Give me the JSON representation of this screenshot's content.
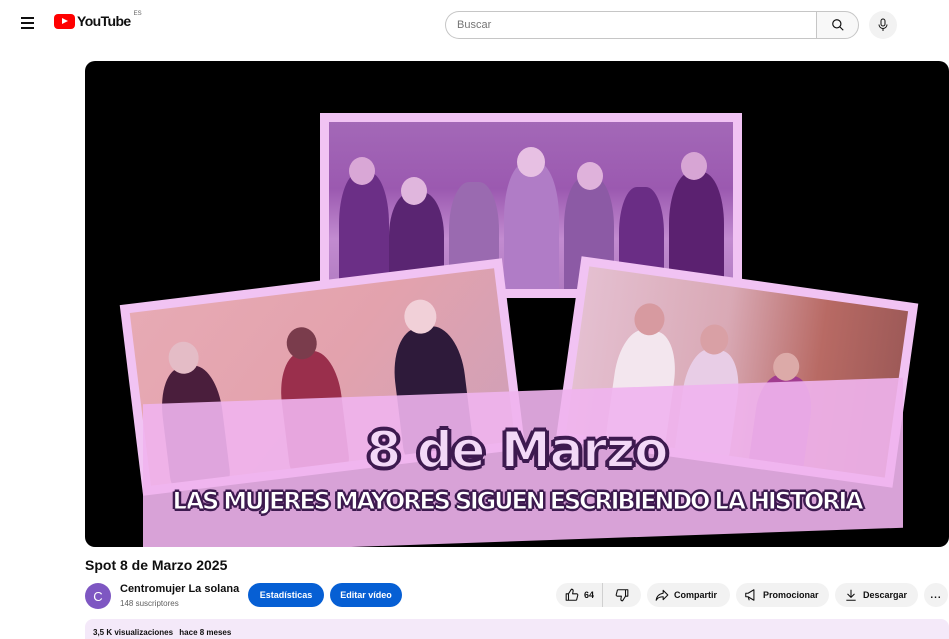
{
  "header": {
    "logo_text": "YouTube",
    "region": "ES",
    "search_placeholder": "Buscar"
  },
  "video": {
    "overlay_title": "8 de Marzo",
    "overlay_subtitle": "LAS MUJERES MAYORES SIGUEN ESCRIBIENDO LA HISTORIA",
    "title": "Spot 8 de Marzo 2025"
  },
  "channel": {
    "avatar_letter": "C",
    "name": "Centromujer La solana",
    "subscribers": "148 suscriptores"
  },
  "actions": {
    "stats_label": "Estadísticas",
    "edit_label": "Editar vídeo",
    "likes": "64",
    "share_label": "Compartir",
    "promote_label": "Promocionar",
    "download_label": "Descargar",
    "more_label": "..."
  },
  "description": {
    "views": "3,5 K visualizaciones",
    "date": "hace 8 meses"
  },
  "colors": {
    "brand_red": "#ff0000",
    "button_blue": "#065fd4",
    "avatar_purple": "#7e57c2",
    "thumb_pink": "#f1c3f3"
  },
  "icons": [
    "menu-icon",
    "youtube-logo-icon",
    "search-icon",
    "mic-icon",
    "thumbs-up-icon",
    "thumbs-down-icon",
    "share-icon",
    "megaphone-icon",
    "download-icon",
    "more-icon"
  ]
}
